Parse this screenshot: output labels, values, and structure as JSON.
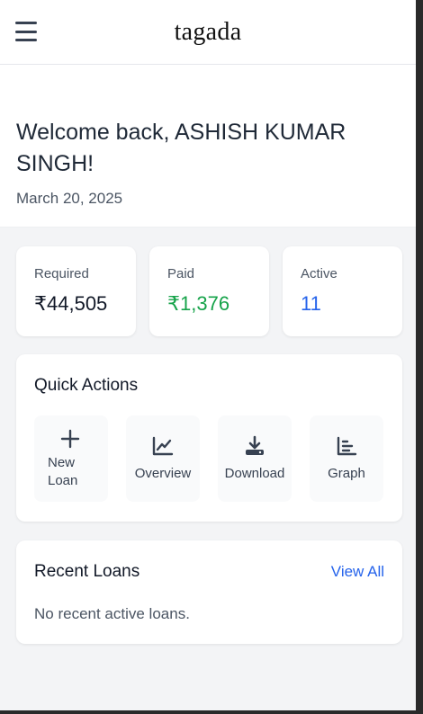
{
  "header": {
    "brand": "tagada"
  },
  "welcome": {
    "greeting": "Welcome back, ASHISH KUMAR SINGH!",
    "date": "March 20, 2025"
  },
  "stats": [
    {
      "label": "Required",
      "value": "₹44,505",
      "color": "#111827"
    },
    {
      "label": "Paid",
      "value": "₹1,376",
      "color": "#16a34a"
    },
    {
      "label": "Active",
      "value": "11",
      "color": "#2563eb"
    }
  ],
  "quick_actions": {
    "title": "Quick Actions",
    "items": [
      {
        "label": "New Loan",
        "icon": "plus-icon"
      },
      {
        "label": "Overview",
        "icon": "trend-chart-icon"
      },
      {
        "label": "Download",
        "icon": "download-icon"
      },
      {
        "label": "Graph",
        "icon": "bar-chart-icon"
      }
    ]
  },
  "recent_loans": {
    "title": "Recent Loans",
    "view_all": "View All",
    "empty": "No recent active loans."
  },
  "colors": {
    "accent": "#2563eb",
    "success": "#16a34a",
    "background": "#f3f4f6"
  }
}
